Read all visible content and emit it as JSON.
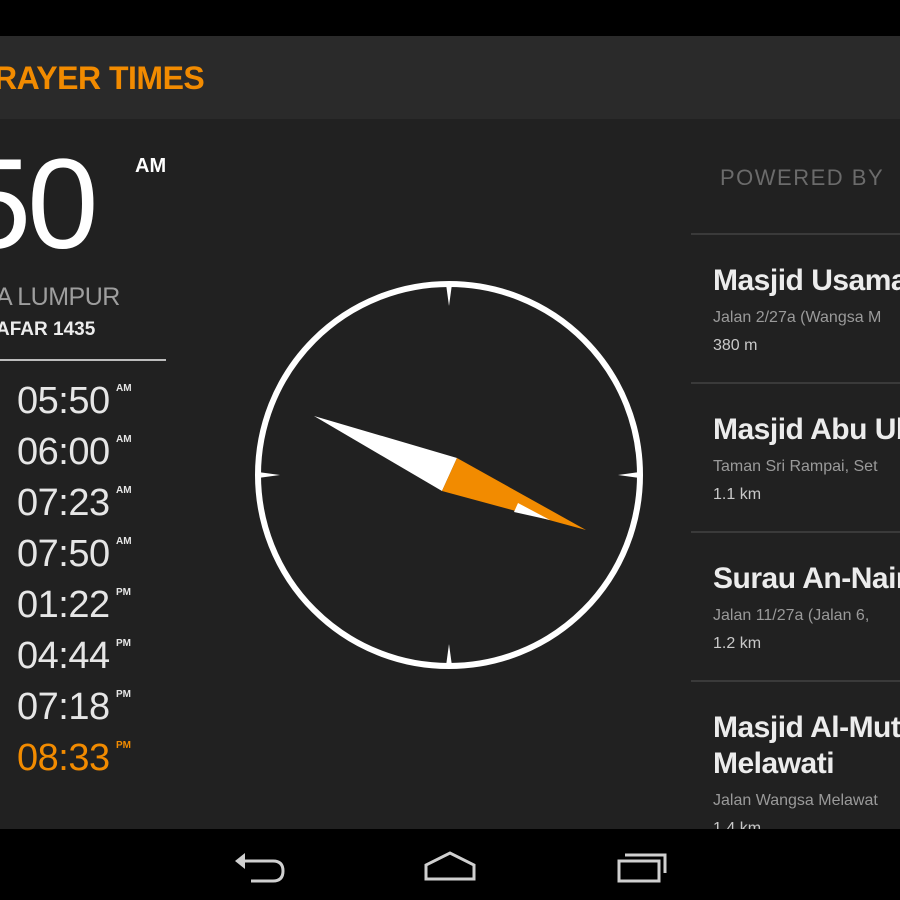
{
  "app": {
    "title": "RAYER TIMES"
  },
  "clock": {
    "time": "50",
    "ampm": "AM",
    "city": "A LUMPUR",
    "hijri_date": "AFAR 1435"
  },
  "prayer_times": [
    {
      "time": "05:50",
      "suffix": "AM",
      "active": false
    },
    {
      "time": "06:00",
      "suffix": "AM",
      "active": false
    },
    {
      "time": "07:23",
      "suffix": "AM",
      "active": false
    },
    {
      "time": "07:50",
      "suffix": "AM",
      "active": false
    },
    {
      "time": "01:22",
      "suffix": "PM",
      "active": false
    },
    {
      "time": "04:44",
      "suffix": "PM",
      "active": false
    },
    {
      "time": "07:18",
      "suffix": "PM",
      "active": false
    },
    {
      "time": "08:33",
      "suffix": "PM",
      "active": true
    }
  ],
  "compass": {
    "needle_colors": {
      "north": "#ffffff",
      "south": "#f28b00"
    }
  },
  "powered_by": "POWERED BY",
  "mosques": [
    {
      "name": "Masjid Usamah",
      "address": "Jalan 2/27a (Wangsa M",
      "distance": "380 m"
    },
    {
      "name": "Masjid Abu Uba",
      "address": "Taman Sri Rampai, Set",
      "distance": "1.1 km"
    },
    {
      "name": "Surau An-Naim",
      "address": "Jalan 11/27a (Jalan 6,",
      "distance": "1.2 km"
    },
    {
      "name_line1": "Masjid Al-Mutt",
      "name_line2": "Melawati",
      "address": "Jalan Wangsa Melawat",
      "distance": "1.4 km"
    }
  ],
  "colors": {
    "accent": "#f28b00",
    "background": "#212121",
    "action_bar": "#2a2a2a"
  },
  "navigation": {
    "back_icon": "back-icon",
    "home_icon": "home-icon",
    "recents_icon": "recents-icon"
  }
}
